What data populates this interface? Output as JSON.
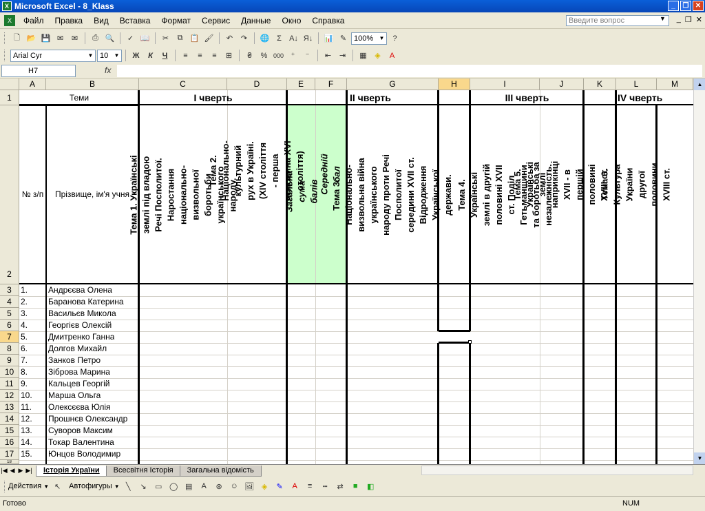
{
  "window": {
    "title": "Microsoft Excel - 8_Klass"
  },
  "menu": [
    "Файл",
    "Правка",
    "Вид",
    "Вставка",
    "Формат",
    "Сервис",
    "Данные",
    "Окно",
    "Справка"
  ],
  "ask": {
    "placeholder": "Введите вопрос"
  },
  "toolbar": {
    "zoom": "100%",
    "font": "Arial Cyr",
    "size": "10",
    "bold": "Ж",
    "italic": "К",
    "underline": "Ч",
    "percent": "%",
    "thousands": "000",
    "sigma": "Σ"
  },
  "formula": {
    "name_box": "H7",
    "fx": "fx"
  },
  "columns": [
    "A",
    "B",
    "C",
    "D",
    "E",
    "F",
    "G",
    "H",
    "I",
    "J",
    "K",
    "L",
    "M"
  ],
  "rows": [
    "1",
    "2",
    "3",
    "4",
    "5",
    "6",
    "7",
    "8",
    "9",
    "10",
    "11",
    "12",
    "13",
    "14",
    "15",
    "16",
    "17",
    "18"
  ],
  "header": {
    "temy": "Теми",
    "q1": "I чверть",
    "q2": "II чверть",
    "q3": "III чверть",
    "q4": "IV чверть",
    "num": "№ з/п",
    "name": "Прізвище, ім'я учня",
    "t1": "Тема 1. Українські землі під владою Речі Посполитої. Наростання національно-визвольної боротьби українського народу.",
    "t2": "Тема 2. Національно-культурний рух в Україні. (XIV століття - перша половина XVI століття)",
    "sum": "Загальна сума балів",
    "avg": "Середній бал",
    "t3": "Тема 3. Національно-визвольна війна українського народу проти Речі Посполитої середини XVII ст. Відродження Української держави.",
    "t4": "Тема 4. Українські землі в другій половині XVII ст. Поділ Гетьманщини та боротьба за незалежність.",
    "t5": "Тема 5. Українські землі наприкінці XVII - в першій половині XVIII ст.",
    "t6": "Тема 6. Культура України другої половини XVIII ст."
  },
  "students": [
    {
      "n": "1.",
      "name": "Андрєєва Олена"
    },
    {
      "n": "2.",
      "name": "Баранова Катерина"
    },
    {
      "n": "3.",
      "name": "Васильєв Микола"
    },
    {
      "n": "4.",
      "name": "Георгієв Олексій"
    },
    {
      "n": "5.",
      "name": "Дмитренко Ганна"
    },
    {
      "n": "6.",
      "name": "Долгов Михайл"
    },
    {
      "n": "7.",
      "name": "Занков Петро"
    },
    {
      "n": "8.",
      "name": "Зіброва Марина"
    },
    {
      "n": "9.",
      "name": "Кальцев Георгій"
    },
    {
      "n": "10.",
      "name": "Марша Ольга"
    },
    {
      "n": "11.",
      "name": "Олексєєва Юлія"
    },
    {
      "n": "12.",
      "name": "Прошнєв Олександр"
    },
    {
      "n": "13.",
      "name": "Суворов Максим"
    },
    {
      "n": "14.",
      "name": "Токар Валентина"
    },
    {
      "n": "15.",
      "name": "Юнцов Володимир"
    }
  ],
  "sheets": [
    "Історія України",
    "Всесвітня Історія",
    "Загальна відомість"
  ],
  "drawbar": {
    "actions": "Действия",
    "autoshapes": "Автофигуры"
  },
  "status": {
    "ready": "Готово",
    "num": "NUM"
  }
}
